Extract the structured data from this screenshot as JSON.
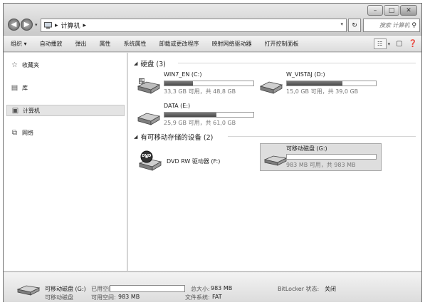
{
  "address": {
    "crumb": "计算机",
    "arrow": "▸",
    "search_placeholder": "搜索 计算机"
  },
  "toolbar": {
    "items": [
      "组织 ▾",
      "自动播放",
      "弹出",
      "属性",
      "系统属性",
      "卸载或更改程序",
      "映射网络驱动器",
      "打开控制面板"
    ]
  },
  "sidebar": {
    "favorites": "收藏夹",
    "libraries": "库",
    "computer": "计算机",
    "network": "网络"
  },
  "groups": {
    "hard_disks": "硬盘 (3)",
    "removable": "有可移动存储的设备 (2)"
  },
  "drives": [
    {
      "name": "WIN7_EN (C:)",
      "info": "33,3 GB 可用，共 48,8 GB",
      "used": 0.32
    },
    {
      "name": "W_VISTAJ (D:)",
      "info": "15,0 GB 可用，共 39,0 GB",
      "used": 0.62
    },
    {
      "name": "DATA (E:)",
      "info": "25,9 GB 可用，共 61,0 GB",
      "used": 0.58
    }
  ],
  "dvd": {
    "name": "DVD RW 驱动器 (F:)",
    "badge": "DVD"
  },
  "removable_drive": {
    "name": "可移动磁盘 (G:)",
    "info": "983 MB 可用，共 983 MB",
    "used": 0.0
  },
  "details": {
    "name": "可移动磁盘 (G:)",
    "type": "可移动磁盘",
    "used_label": "已用空间:",
    "free_label": "可用空间:",
    "free_value": "983 MB",
    "total_label": "总大小:",
    "total_value": "983 MB",
    "fs_label": "文件系统:",
    "fs_value": "FAT",
    "bitlocker_label": "BitLocker 状态:",
    "bitlocker_value": "关闭",
    "used": 0.0
  },
  "colors": {
    "bar_fill": "#5a5a5a",
    "selection": "#dedede"
  }
}
